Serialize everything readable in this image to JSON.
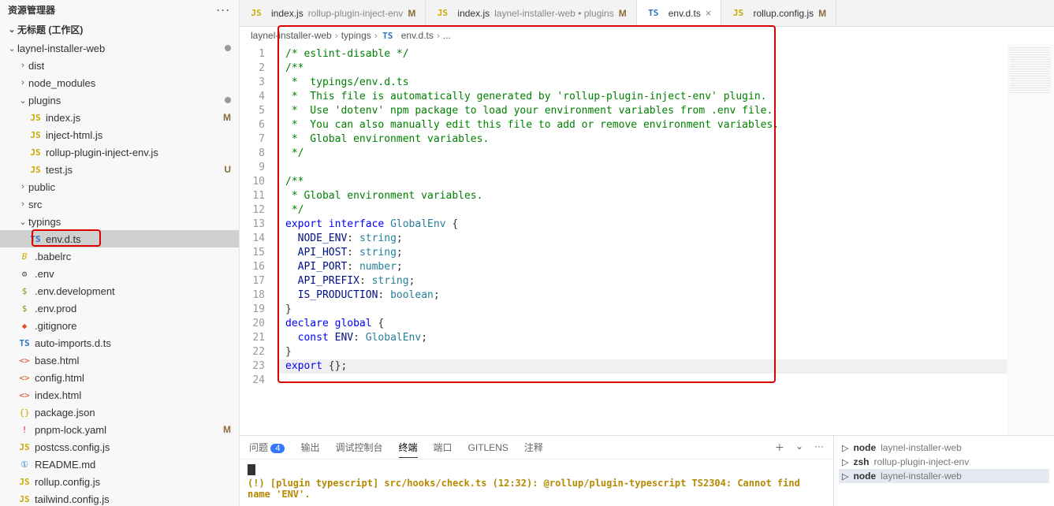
{
  "sidebar": {
    "title": "资源管理器",
    "workspace": "无标题 (工作区)",
    "tree": [
      {
        "label": "laynel-installer-web",
        "indent": 0,
        "icon": "chev-down",
        "badge_dot": true
      },
      {
        "label": "dist",
        "indent": 1,
        "icon": "chev-right"
      },
      {
        "label": "node_modules",
        "indent": 1,
        "icon": "chev-right"
      },
      {
        "label": "plugins",
        "indent": 1,
        "icon": "chev-down",
        "badge_dot": true
      },
      {
        "label": "index.js",
        "indent": 2,
        "icon": "js",
        "badge": "M"
      },
      {
        "label": "inject-html.js",
        "indent": 2,
        "icon": "js"
      },
      {
        "label": "rollup-plugin-inject-env.js",
        "indent": 2,
        "icon": "js"
      },
      {
        "label": "test.js",
        "indent": 2,
        "icon": "js",
        "badge": "U"
      },
      {
        "label": "public",
        "indent": 1,
        "icon": "chev-right"
      },
      {
        "label": "src",
        "indent": 1,
        "icon": "chev-right"
      },
      {
        "label": "typings",
        "indent": 1,
        "icon": "chev-down"
      },
      {
        "label": "env.d.ts",
        "indent": 2,
        "icon": "ts",
        "selected": true,
        "highlighted": true
      },
      {
        "label": ".babelrc",
        "indent": 1,
        "icon": "babel"
      },
      {
        "label": ".env",
        "indent": 1,
        "icon": "gear"
      },
      {
        "label": ".env.development",
        "indent": 1,
        "icon": "dollar"
      },
      {
        "label": ".env.prod",
        "indent": 1,
        "icon": "dollar"
      },
      {
        "label": ".gitignore",
        "indent": 1,
        "icon": "git"
      },
      {
        "label": "auto-imports.d.ts",
        "indent": 1,
        "icon": "ts"
      },
      {
        "label": "base.html",
        "indent": 1,
        "icon": "html"
      },
      {
        "label": "config.html",
        "indent": 1,
        "icon": "html"
      },
      {
        "label": "index.html",
        "indent": 1,
        "icon": "html"
      },
      {
        "label": "package.json",
        "indent": 1,
        "icon": "json"
      },
      {
        "label": "pnpm-lock.yaml",
        "indent": 1,
        "icon": "yaml",
        "badge": "M"
      },
      {
        "label": "postcss.config.js",
        "indent": 1,
        "icon": "js"
      },
      {
        "label": "README.md",
        "indent": 1,
        "icon": "md"
      },
      {
        "label": "rollup.config.js",
        "indent": 1,
        "icon": "js"
      },
      {
        "label": "tailwind.config.js",
        "indent": 1,
        "icon": "js"
      }
    ]
  },
  "tabs": [
    {
      "icon": "js",
      "label": "index.js",
      "suffix": "rollup-plugin-inject-env",
      "badge": "M"
    },
    {
      "icon": "js",
      "label": "index.js",
      "suffix": "laynel-installer-web • plugins",
      "badge": "M"
    },
    {
      "icon": "ts",
      "label": "env.d.ts",
      "active": true,
      "close": true
    },
    {
      "icon": "js",
      "label": "rollup.config.js",
      "badge": "M"
    }
  ],
  "breadcrumb": [
    "laynel-installer-web",
    "typings",
    "env.d.ts",
    "..."
  ],
  "breadcrumb_icon": "TS",
  "code": {
    "lines": [
      {
        "n": 1,
        "html": "<span class='tok-comment'>/* eslint-disable */</span>"
      },
      {
        "n": 2,
        "html": "<span class='tok-comment'>/**</span>"
      },
      {
        "n": 3,
        "html": "<span class='tok-comment'> *  typings/env.d.ts</span>"
      },
      {
        "n": 4,
        "html": "<span class='tok-comment'> *  This file is automatically generated by 'rollup-plugin-inject-env' plugin.</span>"
      },
      {
        "n": 5,
        "html": "<span class='tok-comment'> *  Use 'dotenv' npm package to load your environment variables from .env file.</span>"
      },
      {
        "n": 6,
        "html": "<span class='tok-comment'> *  You can also manually edit this file to add or remove environment variables.</span>"
      },
      {
        "n": 7,
        "html": "<span class='tok-comment'> *  Global environment variables.</span>"
      },
      {
        "n": 8,
        "html": "<span class='tok-comment'> */</span>"
      },
      {
        "n": 9,
        "html": ""
      },
      {
        "n": 10,
        "html": "<span class='tok-comment'>/**</span>"
      },
      {
        "n": 11,
        "html": "<span class='tok-comment'> * Global environment variables.</span>"
      },
      {
        "n": 12,
        "html": "<span class='tok-comment'> */</span>"
      },
      {
        "n": 13,
        "html": "<span class='tok-keyword'>export</span> <span class='tok-keyword'>interface</span> <span class='tok-type'>GlobalEnv</span> {"
      },
      {
        "n": 14,
        "html": "  <span class='tok-prop'>NODE_ENV</span>: <span class='tok-type'>string</span>;"
      },
      {
        "n": 15,
        "html": "  <span class='tok-prop'>API_HOST</span>: <span class='tok-type'>string</span>;"
      },
      {
        "n": 16,
        "html": "  <span class='tok-prop'>API_PORT</span>: <span class='tok-type'>number</span>;"
      },
      {
        "n": 17,
        "html": "  <span class='tok-prop'>API_PREFIX</span>: <span class='tok-type'>string</span>;"
      },
      {
        "n": 18,
        "html": "  <span class='tok-prop'>IS_PRODUCTION</span>: <span class='tok-type'>boolean</span>;"
      },
      {
        "n": 19,
        "html": "}"
      },
      {
        "n": 20,
        "html": "<span class='tok-keyword'>declare</span> <span class='tok-keyword'>global</span> {"
      },
      {
        "n": 21,
        "html": "  <span class='tok-keyword'>const</span> <span class='tok-prop'>ENV</span>: <span class='tok-type'>GlobalEnv</span>;"
      },
      {
        "n": 22,
        "html": "}"
      },
      {
        "n": 23,
        "html": "<span class='tok-keyword'>export</span> {};",
        "hl": true
      },
      {
        "n": 24,
        "html": ""
      }
    ]
  },
  "panel": {
    "tabs": [
      {
        "label": "问题",
        "badge": "4"
      },
      {
        "label": "输出"
      },
      {
        "label": "调试控制台"
      },
      {
        "label": "终端",
        "active": true
      },
      {
        "label": "端口"
      },
      {
        "label": "GITLENS"
      },
      {
        "label": "注释"
      }
    ],
    "terminal_warn": "(!) [plugin typescript] src/hooks/check.ts (12:32): @rollup/plugin-typescript TS2304: Cannot find name 'ENV'.",
    "term_list": [
      {
        "icon": "▷",
        "name": "node",
        "path": "laynel-installer-web"
      },
      {
        "icon": "▷",
        "name": "zsh",
        "path": "rollup-plugin-inject-env"
      },
      {
        "icon": "▷",
        "name": "node",
        "path": "laynel-installer-web",
        "sel": true
      }
    ]
  }
}
